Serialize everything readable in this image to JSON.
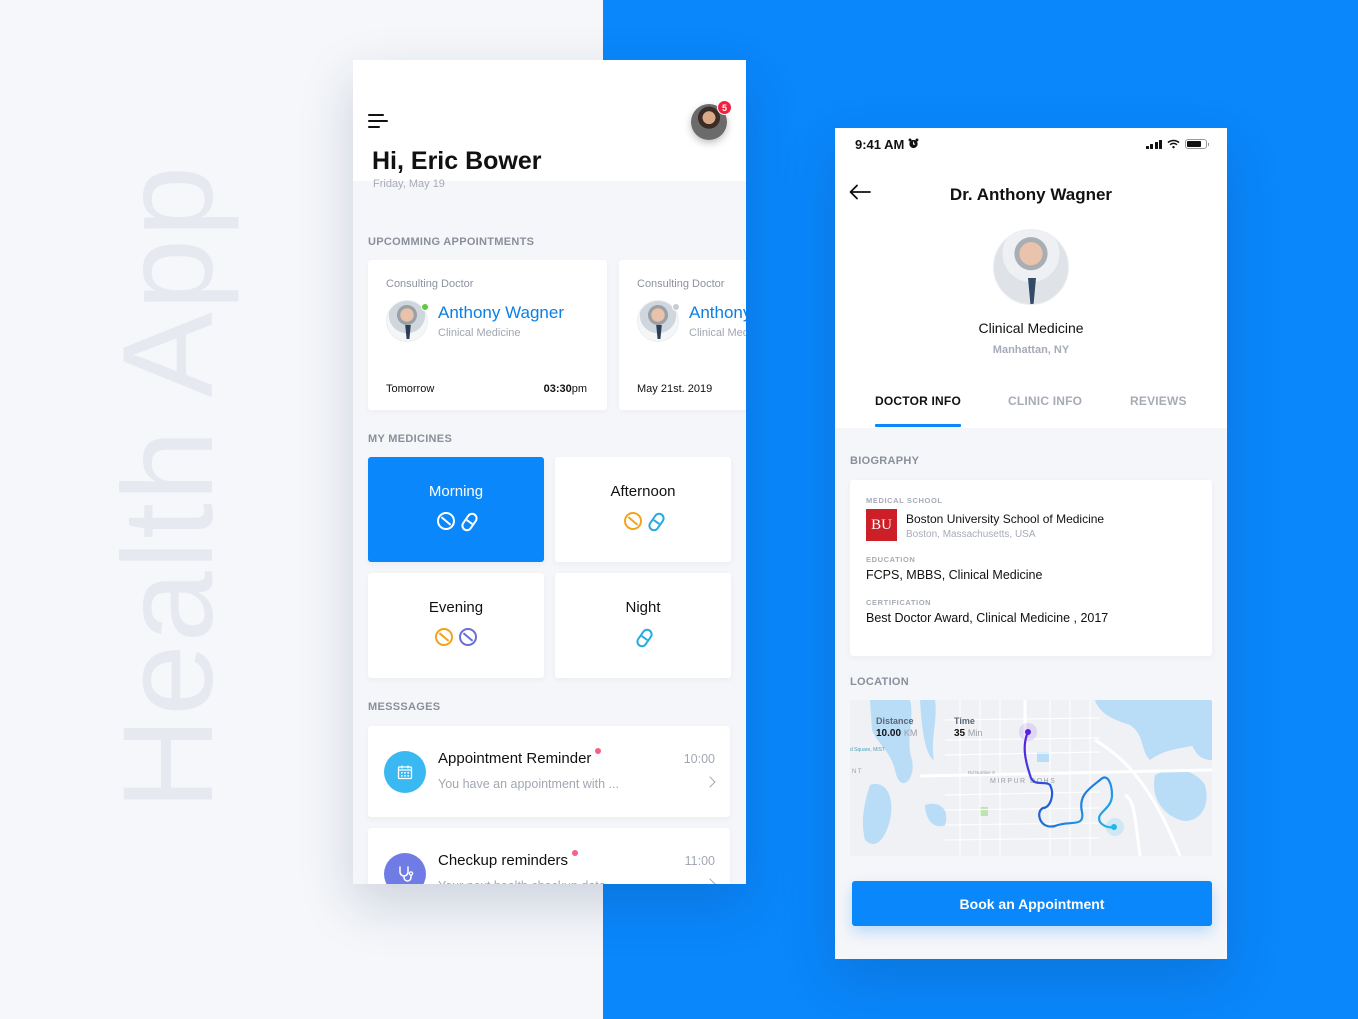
{
  "watermark": "Health App",
  "colors": {
    "primary": "#0a87fb",
    "link": "#0a7fe6",
    "online": "#5ccc3e",
    "badge": "#f0213e",
    "unread_dot": "#f36282",
    "tablet_orange": "#f2a31b",
    "capsule_cyan": "#27a9e1",
    "tablet_purple": "#6a6fd6",
    "appointment_reminder_icon_bg": "#3ab8f2",
    "checkup_icon_bg": "#6f7ce6"
  },
  "home": {
    "status": {
      "time": "9:41 AM",
      "alarm_icon": "alarm-clock-icon"
    },
    "menu_icon": "hamburger-menu-icon",
    "notifications_count": "5",
    "greeting": "Hi, Eric Bower",
    "date": "Friday, May 19",
    "appointments_label": "UPCOMMING APPOINTMENTS",
    "appointments": [
      {
        "role": "Consulting Doctor",
        "name": "Anthony Wagner",
        "specialty": "Clinical Medicine",
        "when": "Tomorrow",
        "time": "03:30",
        "time_suffix": "pm",
        "online": true
      },
      {
        "role": "Consulting Doctor",
        "name": "Anthony Wagner",
        "specialty": "Clinical Medicine",
        "when": "May 21st. 2019",
        "time": "",
        "time_suffix": "",
        "online": false
      }
    ],
    "medicines_label": "MY MEDICINES",
    "medicines": [
      {
        "label": "Morning",
        "active": true,
        "items": [
          "tablet",
          "capsule"
        ]
      },
      {
        "label": "Afternoon",
        "active": false,
        "items": [
          "tablet",
          "capsule"
        ]
      },
      {
        "label": "Evening",
        "active": false,
        "items": [
          "tablet",
          "tablet"
        ]
      },
      {
        "label": "Night",
        "active": false,
        "items": [
          "capsule"
        ]
      }
    ],
    "messages_label": "MESSSAGES",
    "messages": [
      {
        "title": "Appointment Reminder",
        "preview": "You have an appointment with ...",
        "time": "10:00",
        "icon": "calendar-icon",
        "unread": true
      },
      {
        "title": "Checkup reminders",
        "preview": "Your next health checkup date ...",
        "time": "11:00",
        "icon": "stethoscope-icon",
        "unread": true
      }
    ]
  },
  "doctor": {
    "status": {
      "time": "9:41 AM"
    },
    "title": "Dr. Anthony Wagner",
    "specialty": "Clinical Medicine",
    "location": "Manhattan, NY",
    "tabs": [
      {
        "label": "DOCTOR INFO",
        "active": true
      },
      {
        "label": "CLINIC INFO",
        "active": false
      },
      {
        "label": "REVIEWS",
        "active": false
      }
    ],
    "biography_label": "BIOGRAPHY",
    "medical_school_label": "MEDICAL SCHOOL",
    "school_logo_text": "BU",
    "school_name": "Boston University School of Medicine",
    "school_address": "Boston, Massachusetts, USA",
    "education_label": "EDUCATION",
    "education": "FCPS, MBBS, Clinical Medicine",
    "certification_label": "CERTIFICATION",
    "certification": "Best Doctor Award, Clinical Medicine , 2017",
    "location_label": "LOCATION",
    "map": {
      "distance_label": "Distance",
      "distance_value": "10.00",
      "distance_unit": "KM",
      "time_label": "Time",
      "time_value": "35",
      "time_unit": "Min",
      "place_labels": [
        "MIRPUR DOHS",
        "Rd Number 9",
        "d Square, MIST",
        "N T"
      ]
    },
    "book_button": "Book an Appointment"
  }
}
